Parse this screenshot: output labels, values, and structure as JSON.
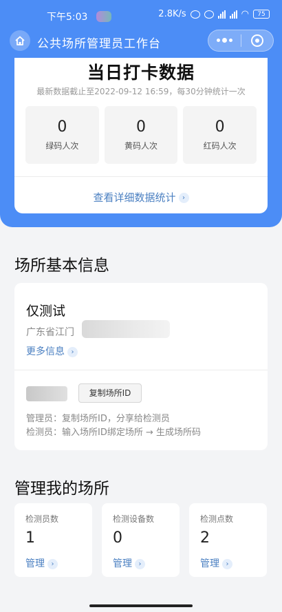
{
  "status_bar": {
    "time": "下午5:03",
    "speed": "2.8K/s",
    "battery": "75"
  },
  "navbar": {
    "title": "公共场所管理员工作台"
  },
  "stats": {
    "title": "当日打卡数据",
    "subtitle": "最新数据截止至2022-09-12 16:59，每30分钟统计一次",
    "items": [
      {
        "value": "0",
        "label": "绿码人次"
      },
      {
        "value": "0",
        "label": "黄码人次"
      },
      {
        "value": "0",
        "label": "红码人次"
      }
    ],
    "detail_link": "查看详细数据统计"
  },
  "place_info": {
    "section_title": "场所基本信息",
    "name": "仅测试",
    "address": "广东省江门",
    "more_link": "更多信息",
    "copy_button": "复制场所ID",
    "hint_admin": "管理员：复制场所ID，分享给检测员",
    "hint_inspector": "检测员：输入场所ID绑定场所 → 生成场所码"
  },
  "manage": {
    "section_title": "管理我的场所",
    "cards": [
      {
        "label": "检测员数",
        "value": "1",
        "link": "管理"
      },
      {
        "label": "检测设备数",
        "value": "0",
        "link": "管理"
      },
      {
        "label": "检测点数",
        "value": "2",
        "link": "管理"
      }
    ]
  }
}
